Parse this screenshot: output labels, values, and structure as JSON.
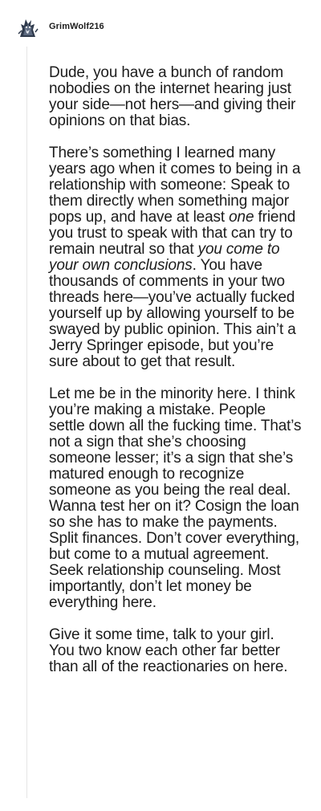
{
  "comment": {
    "username": "GrimWolf216",
    "avatar_icon": "wolf-snoo-avatar-icon",
    "paragraphs": [
      {
        "segments": [
          {
            "text": "Dude, you have a bunch of random nobodies on the internet hearing just your side—not hers—and giving their opinions on that bias.",
            "italic": false
          }
        ]
      },
      {
        "segments": [
          {
            "text": "There’s something I learned many years ago when it comes to being in a relationship with someone: Speak to them directly when something major pops up, and have at least ",
            "italic": false
          },
          {
            "text": "one",
            "italic": true
          },
          {
            "text": " friend you trust to speak with that can try to remain neutral so that ",
            "italic": false
          },
          {
            "text": "you come to your own conclusions",
            "italic": true
          },
          {
            "text": ". You have thousands of comments in your two threads here—you’ve actually fucked yourself up by allowing yourself to be swayed by public opinion. This ain’t a Jerry Springer episode, but you’re sure about to get that result.",
            "italic": false
          }
        ]
      },
      {
        "segments": [
          {
            "text": "Let me be in the minority here. I think you’re making a mistake. People settle down all the fucking time. That’s not a sign that she’s choosing someone lesser; it’s a sign that she’s matured enough to recognize someone as you being the real deal. Wanna test her on it? Cosign the loan so she has to make the payments. Split finances. Don’t cover everything, but come to a mutual agreement. Seek relationship counseling. Most importantly, don’t let money be everything here.",
            "italic": false
          }
        ]
      },
      {
        "segments": [
          {
            "text": "Give it some time, talk to your girl. You two know each other far better than all of the reactionaries on here.",
            "italic": false
          }
        ]
      }
    ]
  }
}
